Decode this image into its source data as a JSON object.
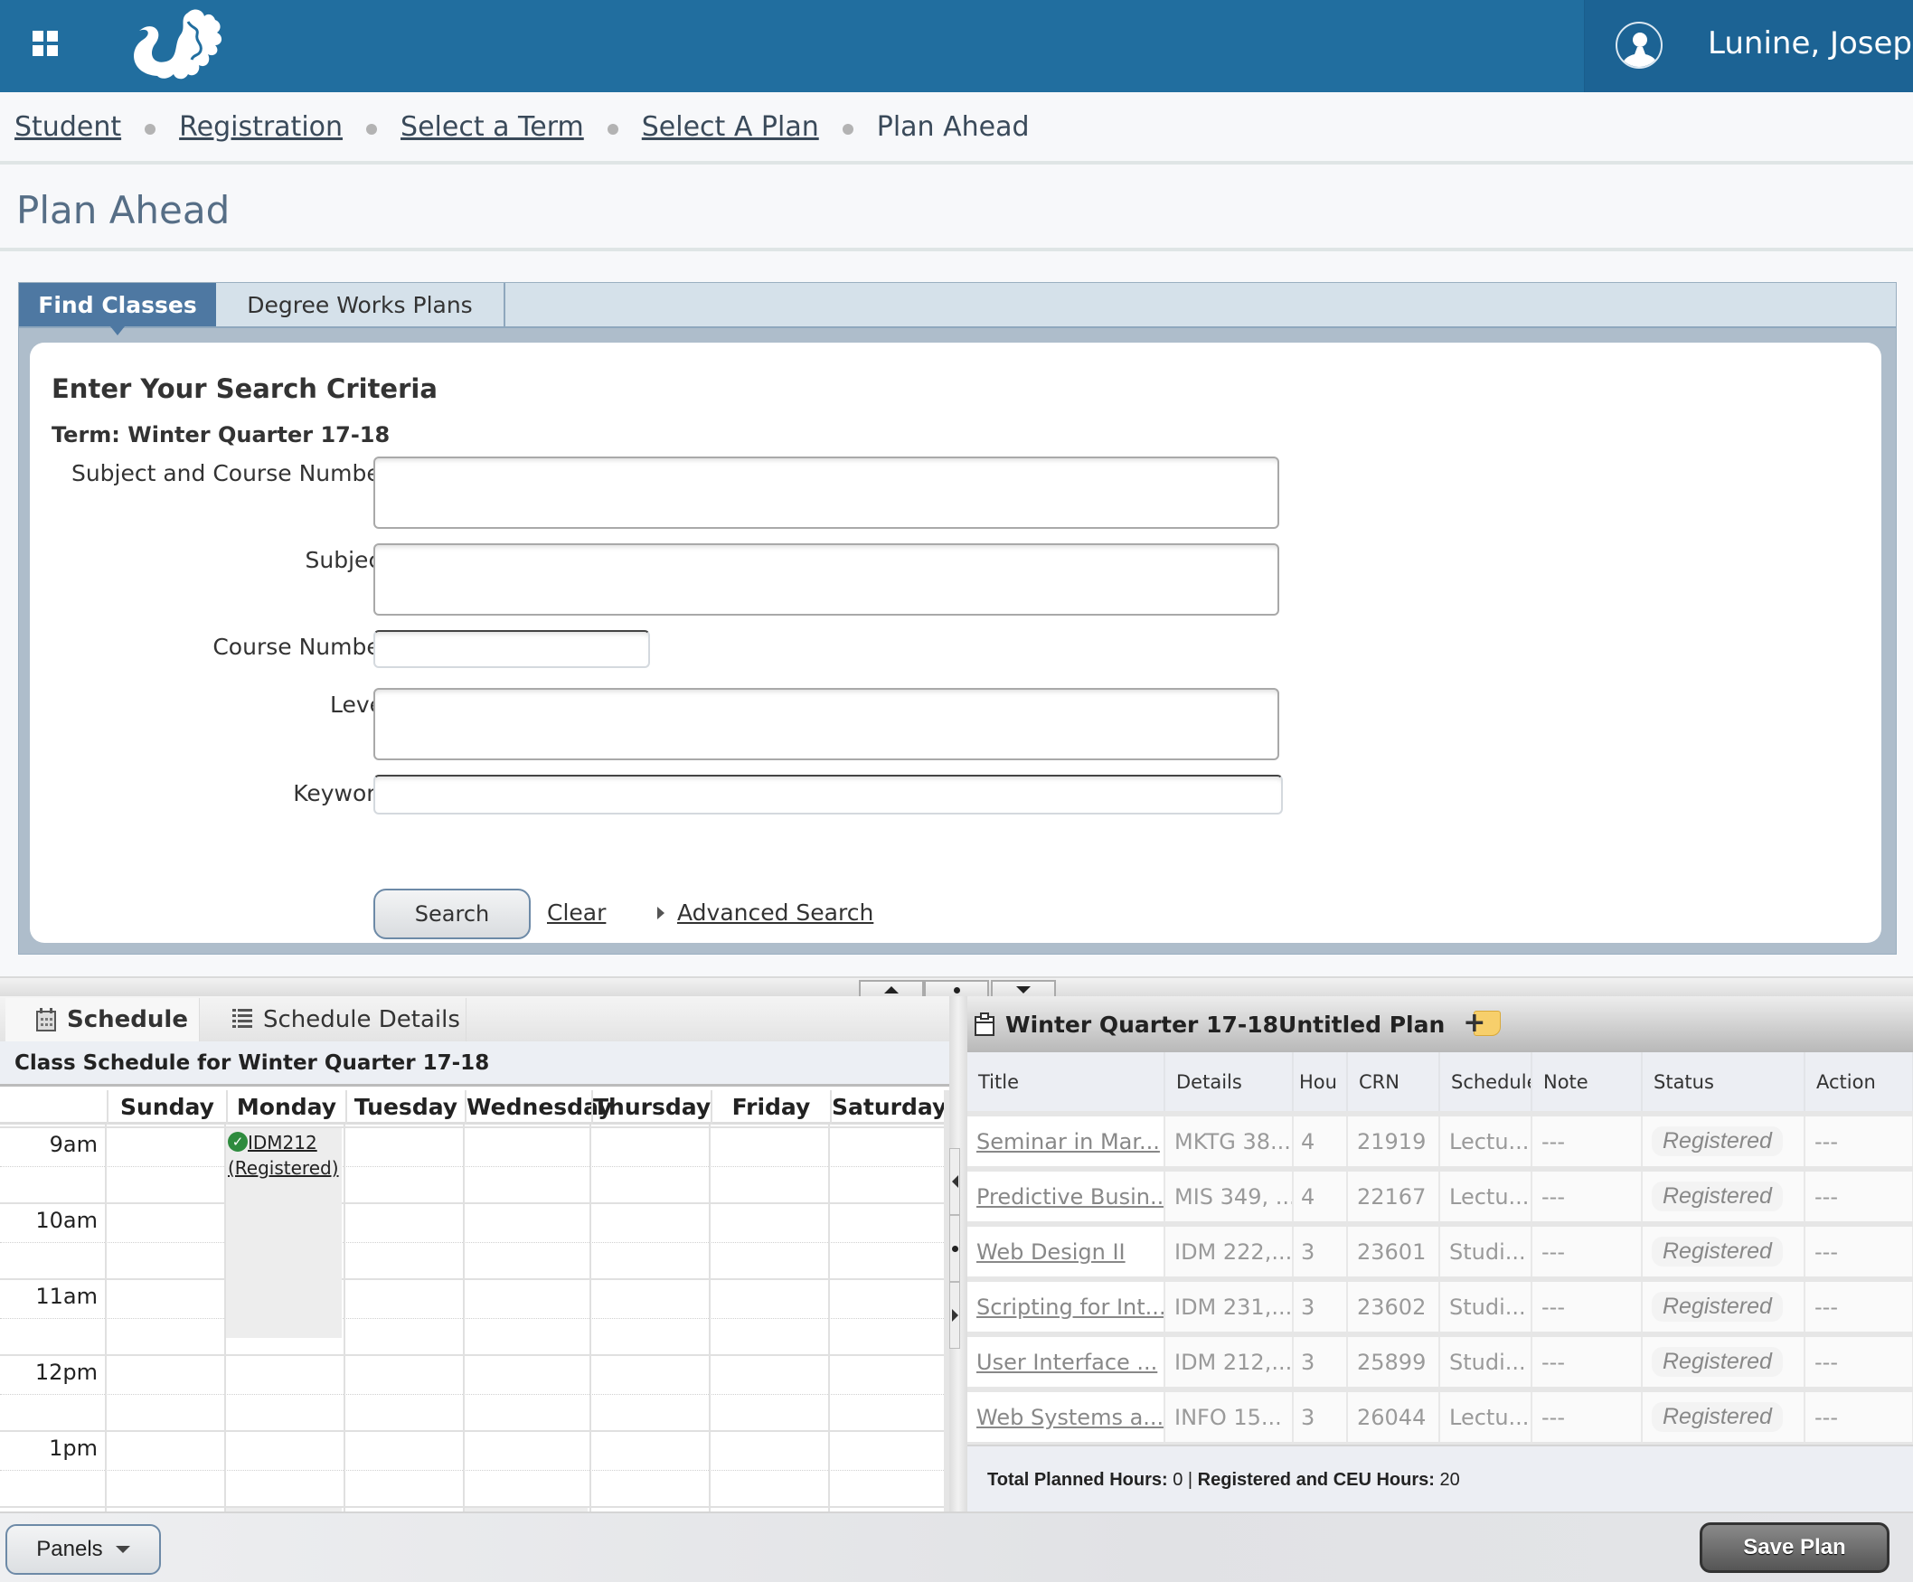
{
  "header": {
    "apps_icon": "apps-grid-icon",
    "logo": "dragon-logo",
    "user_icon": "user-avatar-icon",
    "user_name": "Lunine, Joseph",
    "colors": {
      "bar": "#216E9F",
      "user_area": "#1C6394"
    }
  },
  "breadcrumb": {
    "items": [
      {
        "label": "Student",
        "link": true
      },
      {
        "label": "Registration",
        "link": true
      },
      {
        "label": "Select a Term",
        "link": true
      },
      {
        "label": "Select A Plan",
        "link": true
      },
      {
        "label": "Plan Ahead",
        "link": false
      }
    ]
  },
  "page": {
    "title": "Plan Ahead"
  },
  "search": {
    "tabs": [
      {
        "label": "Find Classes",
        "active": true
      },
      {
        "label": "Degree Works Plans",
        "active": false
      }
    ],
    "heading": "Enter Your Search Criteria",
    "term": "Term: Winter Quarter 17-18",
    "fields": [
      {
        "label": "Subject and Course Number",
        "value": "",
        "placeholder": ""
      },
      {
        "label": "Subject",
        "value": "",
        "placeholder": ""
      },
      {
        "label": "Course Number",
        "value": "",
        "placeholder": ""
      },
      {
        "label": "Level",
        "value": "",
        "placeholder": ""
      },
      {
        "label": "Keyword",
        "value": "",
        "placeholder": ""
      }
    ],
    "search_button": "Search",
    "clear_link": "Clear",
    "advanced_link": "Advanced Search"
  },
  "schedule": {
    "tabs": [
      {
        "label": "Schedule",
        "icon": "calendar-icon",
        "active": true
      },
      {
        "label": "Schedule Details",
        "icon": "list-icon",
        "active": false
      }
    ],
    "title": "Class Schedule for Winter Quarter 17-18",
    "days": [
      "Sunday",
      "Monday",
      "Tuesday",
      "Wednesday",
      "Thursday",
      "Friday",
      "Saturday"
    ],
    "times": [
      "9am",
      "10am",
      "11am",
      "12pm",
      "1pm"
    ],
    "events": [
      {
        "course": "IDM212",
        "status": "(Registered)",
        "day": "Monday",
        "start": "9am",
        "end": "11:50am"
      }
    ]
  },
  "plan": {
    "title": "Winter Quarter 17-18Untitled Plan",
    "add_note_icon": "add-note-icon",
    "columns": [
      "Title",
      "Details",
      "Hou",
      "CRN",
      "Schedule",
      "Note",
      "Status",
      "Action"
    ],
    "rows": [
      {
        "title": "Seminar in Mar...",
        "details": "MKTG 38...",
        "hours": "4",
        "crn": "21919",
        "schedule": "Lectu...",
        "note": "---",
        "status": "Registered",
        "action": "---"
      },
      {
        "title": "Predictive Busin...",
        "details": "MIS 349, ...",
        "hours": "4",
        "crn": "22167",
        "schedule": "Lectu...",
        "note": "---",
        "status": "Registered",
        "action": "---"
      },
      {
        "title": "Web Design II",
        "details": "IDM 222,...",
        "hours": "3",
        "crn": "23601",
        "schedule": "Studi...",
        "note": "---",
        "status": "Registered",
        "action": "---"
      },
      {
        "title": "Scripting for Int...",
        "details": "IDM 231,...",
        "hours": "3",
        "crn": "23602",
        "schedule": "Studi...",
        "note": "---",
        "status": "Registered",
        "action": "---"
      },
      {
        "title": "User Interface ...",
        "details": "IDM 212,...",
        "hours": "3",
        "crn": "25899",
        "schedule": "Studi...",
        "note": "---",
        "status": "Registered",
        "action": "---"
      },
      {
        "title": "Web Systems a...",
        "details": "INFO 15...",
        "hours": "3",
        "crn": "26044",
        "schedule": "Lectu...",
        "note": "---",
        "status": "Registered",
        "action": "---"
      }
    ],
    "footer": {
      "planned_label": "Total Planned Hours:",
      "planned_value": "0",
      "separator": "|",
      "registered_label": "Registered and CEU Hours:",
      "registered_value": "20"
    }
  },
  "footer": {
    "panels_button": "Panels",
    "save_button": "Save Plan"
  }
}
